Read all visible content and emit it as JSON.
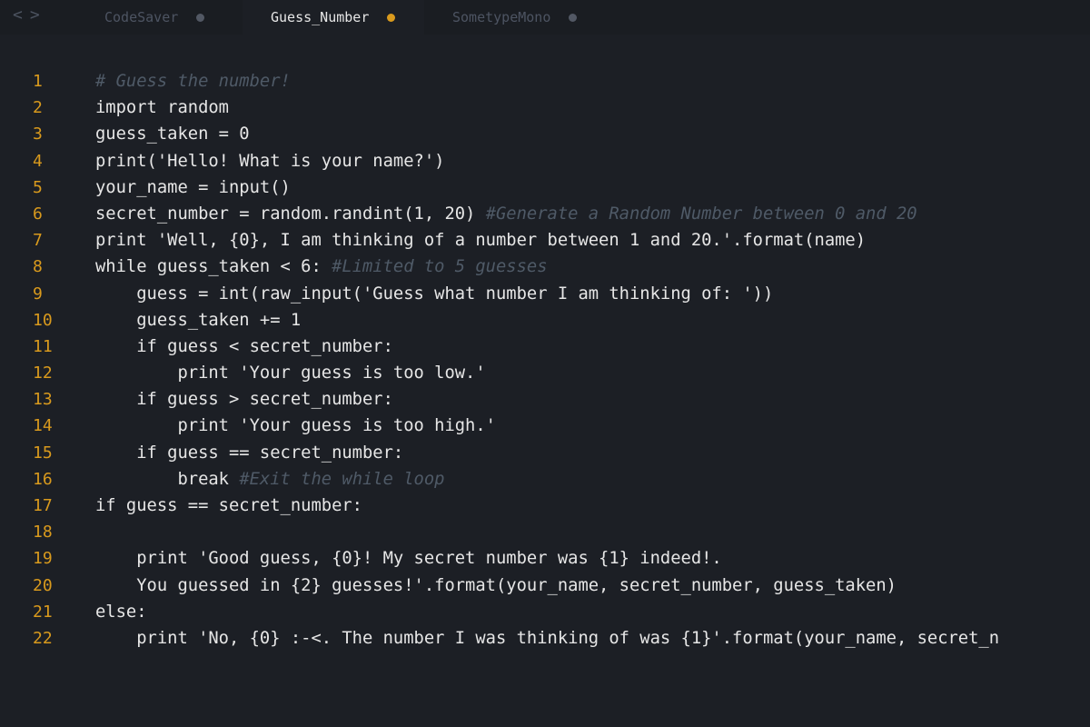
{
  "nav": {
    "back": "<",
    "forward": ">"
  },
  "tabs": [
    {
      "label": "CodeSaver",
      "active": false
    },
    {
      "label": "Guess_Number",
      "active": true
    },
    {
      "label": "SometypeMono",
      "active": false
    }
  ],
  "colors": {
    "background": "#1c1f25",
    "tabbar": "#1a1d22",
    "accent": "#d99a1d",
    "text": "#e6e6e6",
    "comment": "#4f5a67"
  },
  "editor": {
    "lines": [
      {
        "n": "1",
        "code": "",
        "comment": "# Guess the number!"
      },
      {
        "n": "2",
        "code": "import random",
        "comment": ""
      },
      {
        "n": "3",
        "code": "guess_taken = 0",
        "comment": ""
      },
      {
        "n": "4",
        "code": "print('Hello! What is your name?')",
        "comment": ""
      },
      {
        "n": "5",
        "code": "your_name = input()",
        "comment": ""
      },
      {
        "n": "6",
        "code": "secret_number = random.randint(1, 20) ",
        "comment": "#Generate a Random Number between 0 and 20"
      },
      {
        "n": "7",
        "code": "print 'Well, {0}, I am thinking of a number between 1 and 20.'.format(name)",
        "comment": ""
      },
      {
        "n": "8",
        "code": "while guess_taken < 6: ",
        "comment": "#Limited to 5 guesses"
      },
      {
        "n": "9",
        "code": "    guess = int(raw_input('Guess what number I am thinking of: '))",
        "comment": ""
      },
      {
        "n": "10",
        "code": "    guess_taken += 1",
        "comment": ""
      },
      {
        "n": "11",
        "code": "    if guess < secret_number:",
        "comment": ""
      },
      {
        "n": "12",
        "code": "        print 'Your guess is too low.'",
        "comment": ""
      },
      {
        "n": "13",
        "code": "    if guess > secret_number:",
        "comment": ""
      },
      {
        "n": "14",
        "code": "        print 'Your guess is too high.'",
        "comment": ""
      },
      {
        "n": "15",
        "code": "    if guess == secret_number:",
        "comment": ""
      },
      {
        "n": "16",
        "code": "        break ",
        "comment": "#Exit the while loop"
      },
      {
        "n": "17",
        "code": "if guess == secret_number:",
        "comment": ""
      },
      {
        "n": "18",
        "code": "",
        "comment": ""
      },
      {
        "n": "19",
        "code": "    print 'Good guess, {0}! My secret number was {1} indeed!.",
        "comment": ""
      },
      {
        "n": "20",
        "code": "    You guessed in {2} guesses!'.format(your_name, secret_number, guess_taken)",
        "comment": ""
      },
      {
        "n": "21",
        "code": "else:",
        "comment": ""
      },
      {
        "n": "22",
        "code": "    print 'No, {0} :-<. The number I was thinking of was {1}'.format(your_name, secret_n",
        "comment": ""
      }
    ]
  }
}
